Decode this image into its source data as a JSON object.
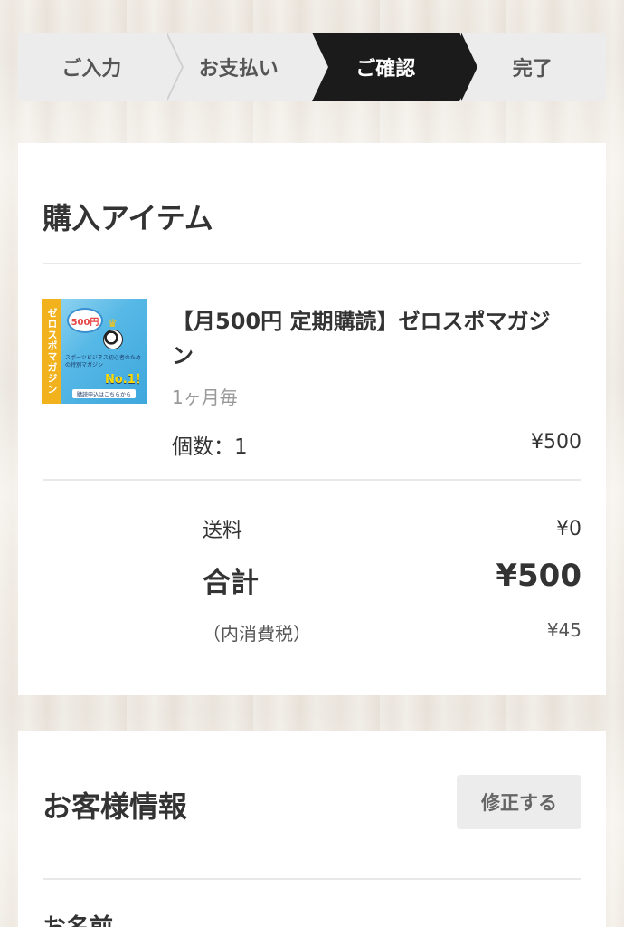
{
  "steps": [
    {
      "label": "ご入力"
    },
    {
      "label": "お支払い"
    },
    {
      "label": "ご確認"
    },
    {
      "label": "完了"
    }
  ],
  "active_step": 2,
  "purchase": {
    "title": "購入アイテム",
    "item": {
      "name": "【月500円 定期購読】ゼロスポマガジン",
      "frequency": "1ヶ月毎",
      "quantity_label": "個数：1",
      "price": "¥500",
      "thumbnail": {
        "stripe_text": "ゼロスポマガジン",
        "coin_text": "500円",
        "tagline": "スポーツビジネス初心者のための特別マガジン",
        "badge": "No.1！",
        "cta": "購読申込はこちらから"
      }
    },
    "shipping_label": "送料",
    "shipping_value": "¥0",
    "total_label": "合計",
    "total_value": "¥500",
    "tax_label": "（内消費税）",
    "tax_value": "¥45"
  },
  "customer": {
    "title": "お客様情報",
    "edit_label": "修正する",
    "name_label": "お名前"
  },
  "colors": {
    "active_step_bg": "#1b1b1b",
    "step_bg": "#ececec",
    "card_bg": "#ffffff"
  }
}
